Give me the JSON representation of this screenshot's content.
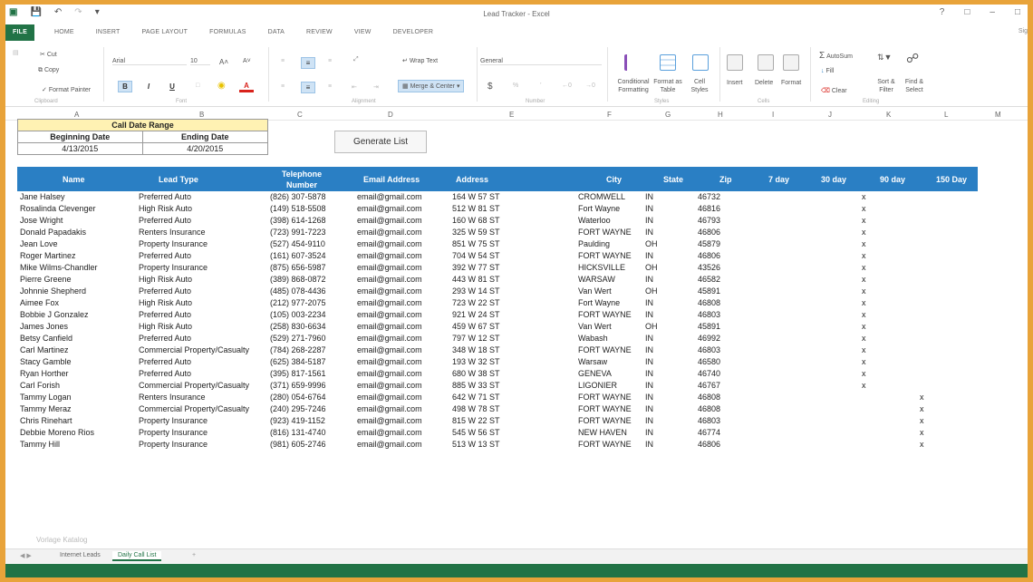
{
  "window": {
    "title": "Lead Tracker - Excel",
    "signin": "Sig"
  },
  "ribbon_tabs": [
    "FILE",
    "HOME",
    "INSERT",
    "PAGE LAYOUT",
    "FORMULAS",
    "DATA",
    "REVIEW",
    "VIEW",
    "DEVELOPER"
  ],
  "ribbon": {
    "cut": "Cut",
    "copy": "Copy",
    "format_painter": "Format Painter",
    "font_name": "Arial",
    "font_size": "10",
    "bold": "B",
    "italic": "I",
    "underline": "U",
    "font_color": "A",
    "wrap_text": "Wrap Text",
    "merge_center": "Merge & Center",
    "number_format": "General",
    "currency": "$",
    "percent": "%",
    "conditional_formatting": "Conditional Formatting",
    "format_as_table": "Format as Table",
    "cell_styles": "Cell Styles",
    "insert": "Insert",
    "delete": "Delete",
    "format": "Format",
    "autosum": "AutoSum",
    "fill": "Fill",
    "clear": "Clear",
    "sort_filter": "Sort & Filter",
    "find_select": "Find & Select",
    "groups": [
      "Clipboard",
      "Font",
      "Alignment",
      "Number",
      "Styles",
      "Cells",
      "Editing"
    ]
  },
  "column_letters": [
    "A",
    "B",
    "C",
    "D",
    "E",
    "F",
    "G",
    "H",
    "I",
    "J",
    "K",
    "L",
    "M"
  ],
  "call_date_range": {
    "title": "Call Date Range",
    "begin_label": "Beginning Date",
    "end_label": "Ending Date",
    "begin_value": "4/13/2015",
    "end_value": "4/20/2015"
  },
  "generate_button": "Generate List",
  "table": {
    "headers": [
      "Name",
      "Lead Type",
      "Telephone Number",
      "Email Address",
      "Address",
      "City",
      "State",
      "Zip",
      "7 day",
      "30 day",
      "90 day",
      "150 Day"
    ],
    "rows": [
      [
        "Jane Halsey",
        "Preferred Auto",
        "(826) 307-5878",
        "email@gmail.com",
        "164 W 57 ST",
        "CROMWELL",
        "IN",
        "46732",
        "",
        "",
        "x",
        ""
      ],
      [
        "Rosalinda Clevenger",
        "High Risk Auto",
        "(149) 518-5508",
        "email@gmail.com",
        "512 W 81 ST",
        "Fort Wayne",
        "IN",
        "46816",
        "",
        "",
        "x",
        ""
      ],
      [
        "Jose Wright",
        "Preferred Auto",
        "(398) 614-1268",
        "email@gmail.com",
        "160 W 68 ST",
        "Waterloo",
        "IN",
        "46793",
        "",
        "",
        "x",
        ""
      ],
      [
        "Donald Papadakis",
        "Renters Insurance",
        "(723) 991-7223",
        "email@gmail.com",
        "325 W 59 ST",
        "FORT WAYNE",
        "IN",
        "46806",
        "",
        "",
        "x",
        ""
      ],
      [
        "Jean Love",
        "Property Insurance",
        "(527) 454-9110",
        "email@gmail.com",
        "851 W 75 ST",
        "Paulding",
        "OH",
        "45879",
        "",
        "",
        "x",
        ""
      ],
      [
        "Roger Martinez",
        "Preferred Auto",
        "(161) 607-3524",
        "email@gmail.com",
        "704 W 54 ST",
        "FORT WAYNE",
        "IN",
        "46806",
        "",
        "",
        "x",
        ""
      ],
      [
        "Mike Wilms-Chandler",
        "Property Insurance",
        "(875) 656-5987",
        "email@gmail.com",
        "392 W 77 ST",
        "HICKSVILLE",
        "OH",
        "43526",
        "",
        "",
        "x",
        ""
      ],
      [
        "Pierre Greene",
        "High Risk Auto",
        "(389) 868-0872",
        "email@gmail.com",
        "443 W 81 ST",
        "WARSAW",
        "IN",
        "46582",
        "",
        "",
        "x",
        ""
      ],
      [
        "Johnnie Shepherd",
        "Preferred Auto",
        "(485) 078-4436",
        "email@gmail.com",
        "293 W 14 ST",
        "Van Wert",
        "OH",
        "45891",
        "",
        "",
        "x",
        ""
      ],
      [
        "Aimee Fox",
        "High Risk Auto",
        "(212) 977-2075",
        "email@gmail.com",
        "723 W 22 ST",
        "Fort Wayne",
        "IN",
        "46808",
        "",
        "",
        "x",
        ""
      ],
      [
        "Bobbie J Gonzalez",
        "Preferred Auto",
        "(105) 003-2234",
        "email@gmail.com",
        "921 W 24 ST",
        "FORT WAYNE",
        "IN",
        "46803",
        "",
        "",
        "x",
        ""
      ],
      [
        "James Jones",
        "High Risk Auto",
        "(258) 830-6634",
        "email@gmail.com",
        "459 W 67 ST",
        "Van Wert",
        "OH",
        "45891",
        "",
        "",
        "x",
        ""
      ],
      [
        "Betsy Canfield",
        "Preferred Auto",
        "(529) 271-7960",
        "email@gmail.com",
        "797 W 12 ST",
        "Wabash",
        "IN",
        "46992",
        "",
        "",
        "x",
        ""
      ],
      [
        "Carl Martinez",
        "Commercial Property/Casualty",
        "(784) 268-2287",
        "email@gmail.com",
        "348 W 18 ST",
        "FORT WAYNE",
        "IN",
        "46803",
        "",
        "",
        "x",
        ""
      ],
      [
        "Stacy Gamble",
        "Preferred Auto",
        "(625) 384-5187",
        "email@gmail.com",
        "193 W 32 ST",
        "Warsaw",
        "IN",
        "46580",
        "",
        "",
        "x",
        ""
      ],
      [
        "Ryan Horther",
        "Preferred Auto",
        "(395) 817-1561",
        "email@gmail.com",
        "680 W 38 ST",
        "GENEVA",
        "IN",
        "46740",
        "",
        "",
        "x",
        ""
      ],
      [
        "Carl Forish",
        "Commercial Property/Casualty",
        "(371) 659-9996",
        "email@gmail.com",
        "885 W 33 ST",
        "LIGONIER",
        "IN",
        "46767",
        "",
        "",
        "x",
        ""
      ],
      [
        "Tammy Logan",
        "Renters Insurance",
        "(280) 054-6764",
        "email@gmail.com",
        "642 W 71 ST",
        "FORT WAYNE",
        "IN",
        "46808",
        "",
        "",
        "",
        "x"
      ],
      [
        "Tammy Meraz",
        "Commercial Property/Casualty",
        "(240) 295-7246",
        "email@gmail.com",
        "498 W 78 ST",
        "FORT WAYNE",
        "IN",
        "46808",
        "",
        "",
        "",
        "x"
      ],
      [
        "Chris Rinehart",
        "Property Insurance",
        "(923) 419-1152",
        "email@gmail.com",
        "815 W 22 ST",
        "FORT WAYNE",
        "IN",
        "46803",
        "",
        "",
        "",
        "x"
      ],
      [
        "Debbie Moreno Rios",
        "Property Insurance",
        "(816) 131-4740",
        "email@gmail.com",
        "545 W 56 ST",
        "NEW HAVEN",
        "IN",
        "46774",
        "",
        "",
        "",
        "x"
      ],
      [
        "Tammy Hill",
        "Property Insurance",
        "(981) 605-2746",
        "email@gmail.com",
        "513 W 13 ST",
        "FORT WAYNE",
        "IN",
        "46806",
        "",
        "",
        "",
        "x"
      ]
    ]
  },
  "watermark": "Vorlage Katalog",
  "sheet_tabs": [
    "Internet Leads",
    "Daily Call List"
  ],
  "active_sheet": "Daily Call List",
  "colors": {
    "excel_green": "#217346",
    "table_header": "#2a7fc4",
    "range_title": "#fff2b3"
  }
}
